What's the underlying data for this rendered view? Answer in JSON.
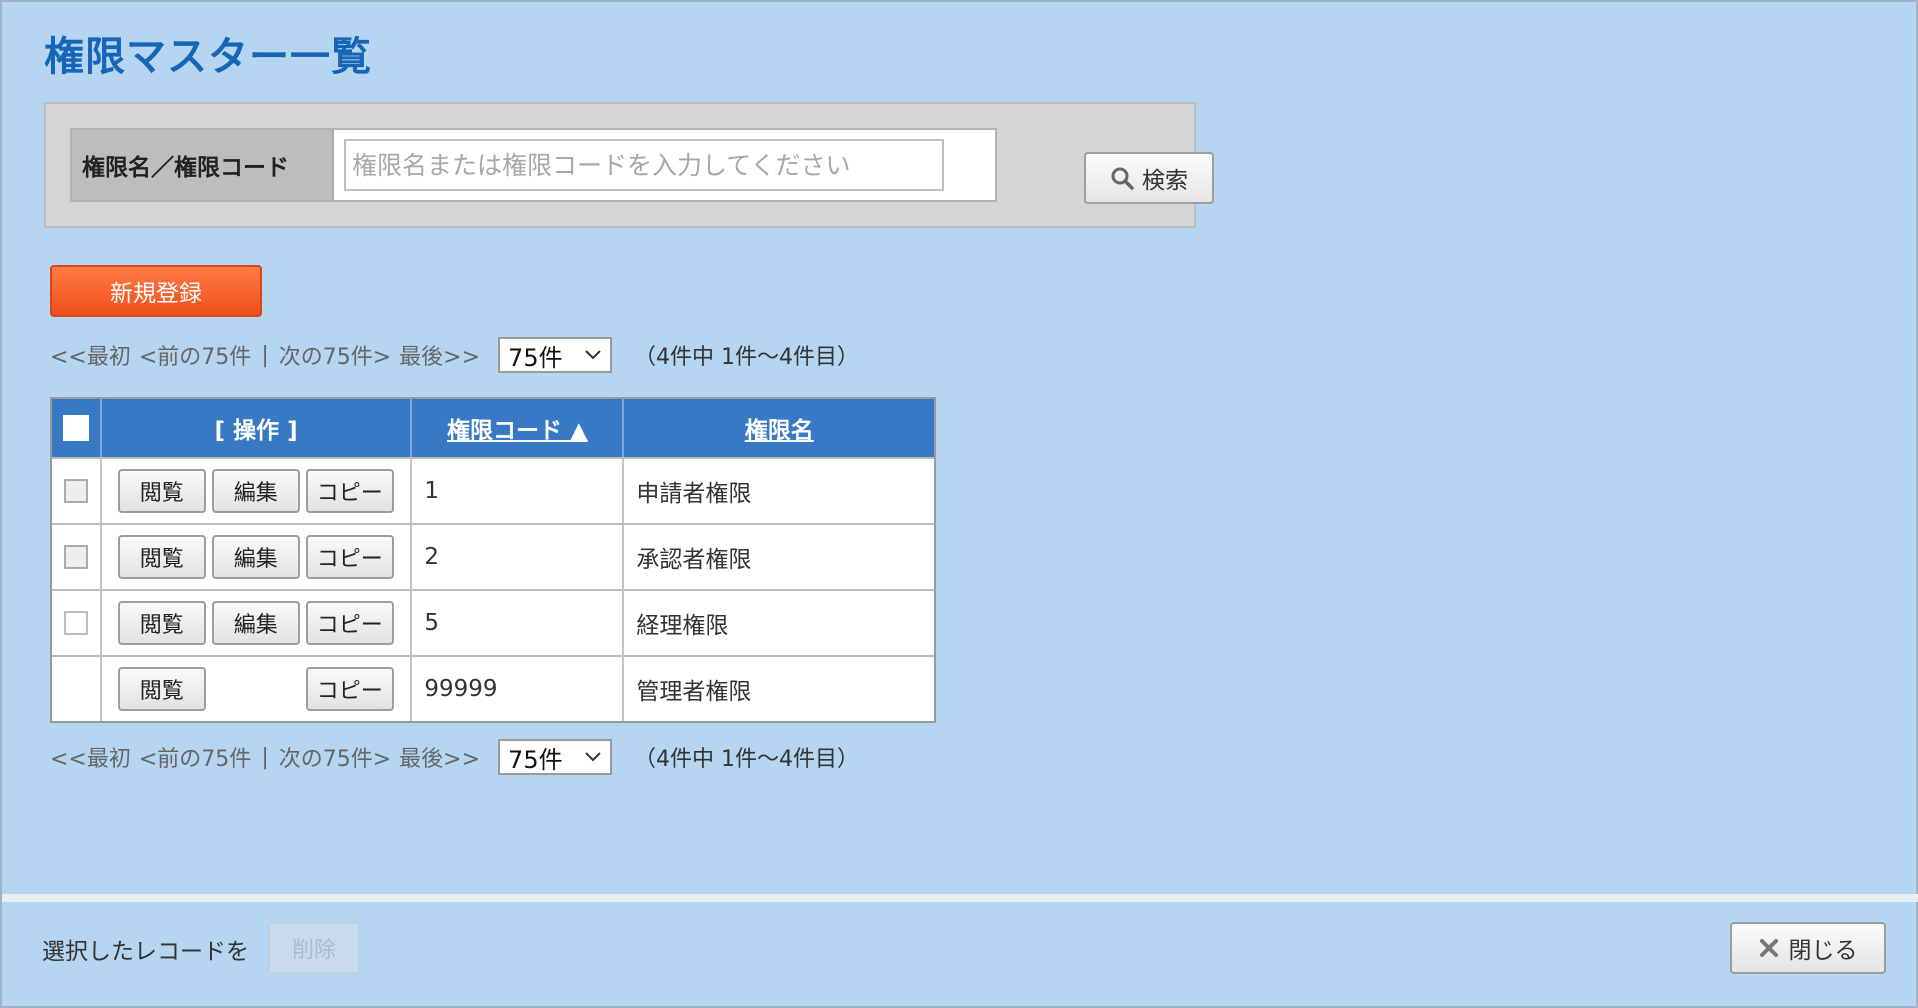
{
  "page": {
    "title": "権限マスター一覧"
  },
  "search": {
    "label": "権限名／権限コード",
    "placeholder": "権限名または権限コードを入力してください",
    "value": "",
    "button_label": "検索"
  },
  "new_button_label": "新規登録",
  "pager": {
    "first": "<<最初",
    "prev": "<前の75件",
    "separator": "|",
    "next": "次の75件>",
    "last": "最後>>",
    "per_page": "75件",
    "info": "（4件中 1件〜4件目）"
  },
  "table": {
    "headers": {
      "ops": "[ 操作 ]",
      "code": "権限コード ▲",
      "name": "権限名"
    },
    "buttons": {
      "view": "閲覧",
      "edit": "編集",
      "copy": "コピー"
    },
    "rows": [
      {
        "code": "1",
        "name": "申請者権限"
      },
      {
        "code": "2",
        "name": "承認者権限"
      },
      {
        "code": "5",
        "name": "経理権限"
      },
      {
        "code": "99999",
        "name": "管理者権限"
      }
    ]
  },
  "footer": {
    "selection_label": "選択したレコードを",
    "delete_label": "削除",
    "close_label": "閉じる"
  },
  "colors": {
    "background": "#b5d5f0",
    "title": "#1565b8",
    "table_header": "#3879c5",
    "primary_button": "#f04f1a"
  }
}
